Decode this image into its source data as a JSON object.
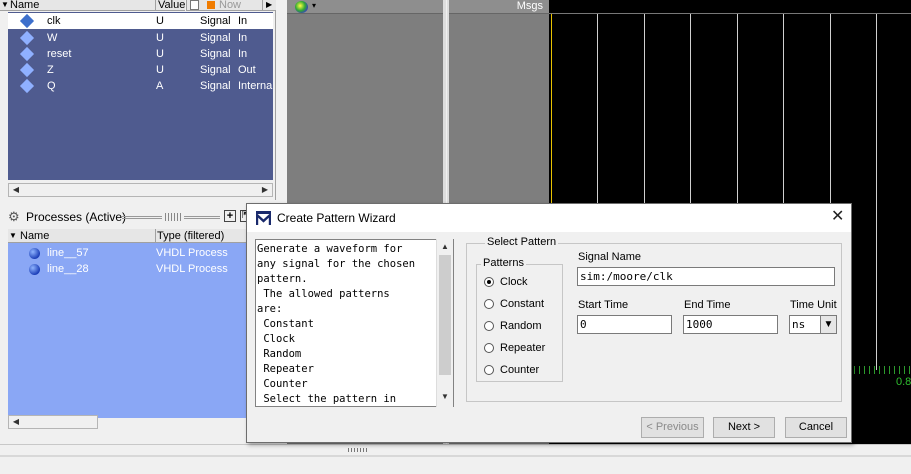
{
  "objects": {
    "headers": {
      "name": "Name",
      "value": "Value",
      "now": "Now"
    },
    "rows": [
      {
        "name": "clk",
        "value": "U",
        "kind": "Signal",
        "mode": "In"
      },
      {
        "name": "W",
        "value": "U",
        "kind": "Signal",
        "mode": "In"
      },
      {
        "name": "reset",
        "value": "U",
        "kind": "Signal",
        "mode": "In"
      },
      {
        "name": "Z",
        "value": "U",
        "kind": "Signal",
        "mode": "Out"
      },
      {
        "name": "Q",
        "value": "A",
        "kind": "Signal",
        "mode": "Interna"
      }
    ]
  },
  "processes": {
    "title": "Processes (Active)",
    "col_name": "Name",
    "col_type": "Type (filtered)",
    "rows": [
      {
        "name": "line__57",
        "type": "VHDL Process"
      },
      {
        "name": "line__28",
        "type": "VHDL Process"
      }
    ]
  },
  "wave": {
    "msgs_label": "Msgs",
    "cursor_value": "0.8"
  },
  "dialog": {
    "title": "Create Pattern Wizard",
    "description": "Generate a waveform for\nany signal for the chosen\npattern.\n The allowed patterns\nare:\n Constant\n Clock\n Random\n Repeater\n Counter\n Select the pattern in",
    "select_pattern_label": "Select Pattern",
    "patterns_label": "Patterns",
    "patterns": [
      "Clock",
      "Constant",
      "Random",
      "Repeater",
      "Counter"
    ],
    "selected_pattern": "Clock",
    "signal_name_label": "Signal Name",
    "signal_name": "sim:/moore/clk",
    "start_time_label": "Start Time",
    "start_time": "0",
    "end_time_label": "End Time",
    "end_time": "1000",
    "time_unit_label": "Time Unit",
    "time_unit": "ns",
    "buttons": {
      "previous": "< Previous",
      "next": "Next >",
      "cancel": "Cancel"
    }
  }
}
